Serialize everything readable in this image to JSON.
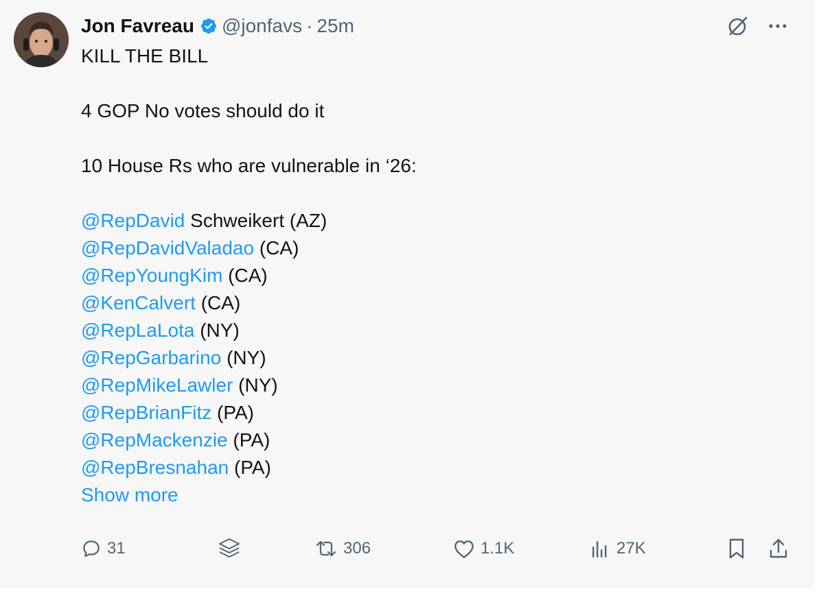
{
  "author": {
    "name": "Jon Favreau",
    "handle": "@jonfavs",
    "separator": "·",
    "time": "25m"
  },
  "tweet": {
    "line1": "KILL THE BILL",
    "line2": "4 GOP No votes should do it",
    "line3": "10 House Rs who are vulnerable in ‘26:",
    "mentions": [
      {
        "handle": "@RepDavid",
        "suffix": " Schweikert (AZ)"
      },
      {
        "handle": "@RepDavidValadao",
        "suffix": " (CA)"
      },
      {
        "handle": "@RepYoungKim",
        "suffix": " (CA)"
      },
      {
        "handle": "@KenCalvert",
        "suffix": " (CA)"
      },
      {
        "handle": "@RepLaLota",
        "suffix": " (NY)"
      },
      {
        "handle": "@RepGarbarino",
        "suffix": " (NY)"
      },
      {
        "handle": "@RepMikeLawler",
        "suffix": " (NY)"
      },
      {
        "handle": "@RepBrianFitz",
        "suffix": " (PA)"
      },
      {
        "handle": "@RepMackenzie",
        "suffix": " (PA)"
      },
      {
        "handle": "@RepBresnahan",
        "suffix": " (PA)"
      }
    ],
    "show_more": "Show more"
  },
  "actions": {
    "replies": "31",
    "reposts": "306",
    "likes": "1.1K",
    "views": "27K"
  },
  "icons": {
    "verified": "verified-badge-icon",
    "grok": "grok-icon",
    "more": "more-horizontal-icon",
    "reply": "reply-icon",
    "stack": "layers-icon",
    "repost": "repost-icon",
    "like": "heart-icon",
    "views": "views-chart-icon",
    "bookmark": "bookmark-icon",
    "share": "share-icon"
  },
  "colors": {
    "link": "#1d9bf0",
    "text": "#0f1419",
    "muted": "#536471",
    "background": "#f7f7f7"
  }
}
